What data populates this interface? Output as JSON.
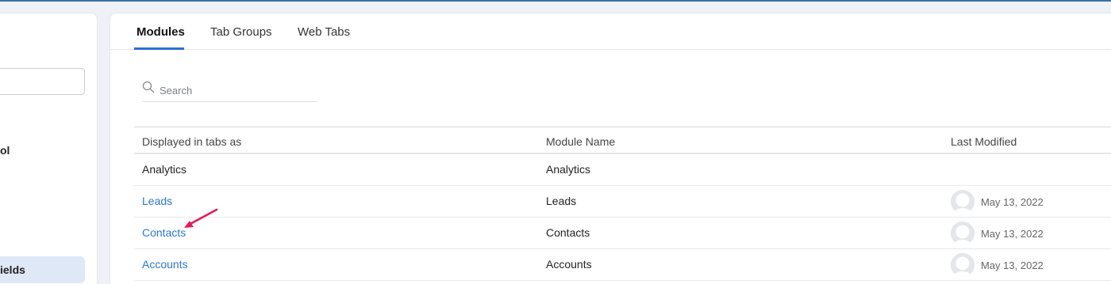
{
  "sidebar": {
    "partial_label": "ol",
    "active_item_label": "ields"
  },
  "tabs": [
    {
      "label": "Modules",
      "active": true
    },
    {
      "label": "Tab Groups",
      "active": false
    },
    {
      "label": "Web Tabs",
      "active": false
    }
  ],
  "search": {
    "placeholder": "Search",
    "value": ""
  },
  "table": {
    "headers": [
      "Displayed in tabs as",
      "Module Name",
      "Last Modified"
    ],
    "rows": [
      {
        "displayed": "Analytics",
        "module": "Analytics",
        "modified": "",
        "link": false
      },
      {
        "displayed": "Leads",
        "module": "Leads",
        "modified": "May 13, 2022",
        "link": true
      },
      {
        "displayed": "Contacts",
        "module": "Contacts",
        "modified": "May 13, 2022",
        "link": true
      },
      {
        "displayed": "Accounts",
        "module": "Accounts",
        "modified": "May 13, 2022",
        "link": true
      }
    ]
  },
  "colors": {
    "accent": "#2b6fd6",
    "link": "#2b76d8",
    "annotation_arrow": "#e8185a"
  }
}
